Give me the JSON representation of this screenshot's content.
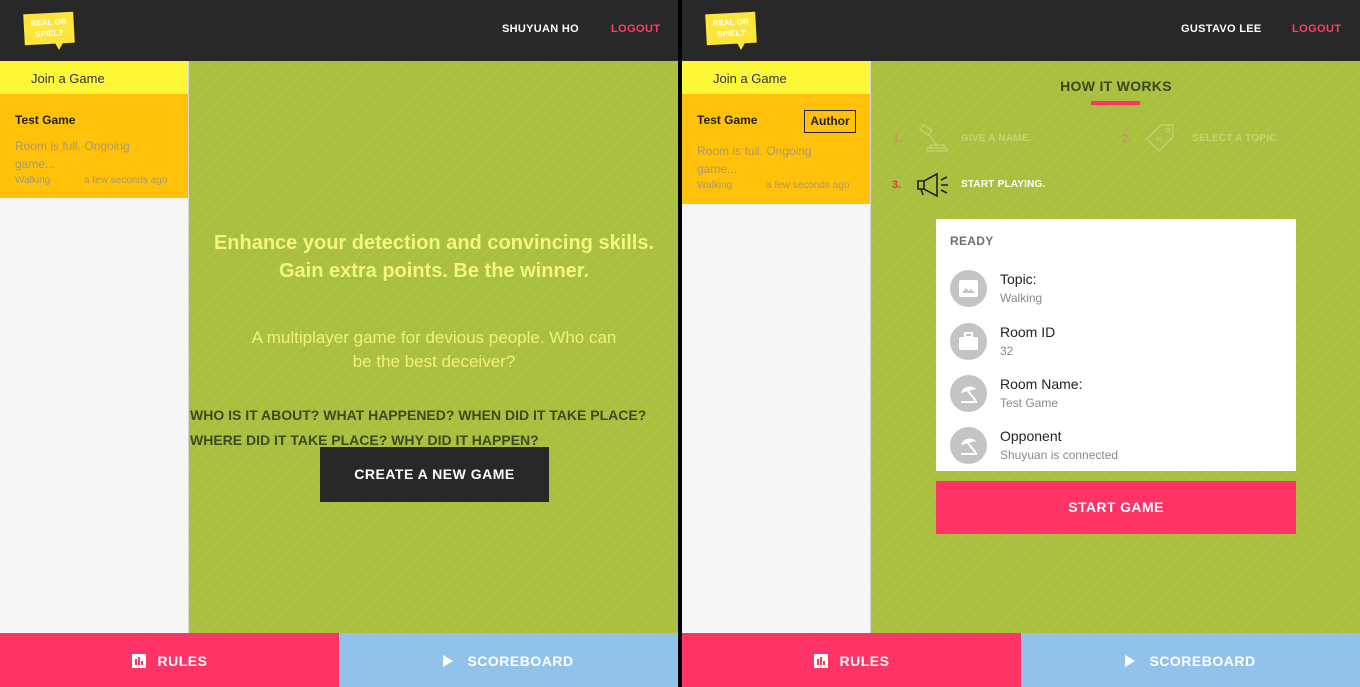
{
  "logo": {
    "line1": "REAL OR",
    "line2": "SPIEL?"
  },
  "left_screen": {
    "user_name": "SHUYUAN HO",
    "logout": "LOGOUT",
    "join_tab": "Join a Game",
    "game": {
      "title": "Test Game",
      "status": "Room is full. Ongoing game...",
      "topic": "Walking",
      "time": "a few seconds ago"
    },
    "hero_title": "Enhance your detection and convincing skills. Gain extra points. Be the winner.",
    "hero_subtitle": "A multiplayer game for devious people. Who can be the best deceiver?",
    "questions_line1": "WHO IS IT ABOUT? WHAT HAPPENED? WHEN DID IT TAKE PLACE?",
    "questions_line2": "WHERE DID IT TAKE PLACE? WHY DID IT HAPPEN?",
    "create_button": "CREATE A NEW GAME",
    "rules": "RULES",
    "scoreboard": "SCOREBOARD"
  },
  "right_screen": {
    "user_name": "GUSTAVO LEE",
    "logout": "LOGOUT",
    "join_tab": "Join a Game",
    "game": {
      "title": "Test Game",
      "author_badge": "Author",
      "status": "Room is full. Ongoing game...",
      "topic": "Walking",
      "time": "a few seconds ago"
    },
    "how_it_works": "HOW IT WORKS",
    "steps": [
      {
        "num": "1.",
        "label": "GIVE A NAME.",
        "icon": "gavel-icon"
      },
      {
        "num": "2.",
        "label": "SELECT A TOPIC.",
        "icon": "tag-icon"
      },
      {
        "num": "3.",
        "label": "START PLAYING.",
        "icon": "megaphone-icon"
      }
    ],
    "ready_label": "READY",
    "info": [
      {
        "label": "Topic:",
        "value": "Walking",
        "icon": "image-icon"
      },
      {
        "label": "Room ID",
        "value": "32",
        "icon": "briefcase-icon"
      },
      {
        "label": "Room Name:",
        "value": "Test Game",
        "icon": "beach-umbrella-icon"
      },
      {
        "label": "Opponent",
        "value": "Shuyuan is connected",
        "icon": "beach-umbrella-icon"
      }
    ],
    "start_button": "START GAME",
    "rules": "RULES",
    "scoreboard": "SCOREBOARD"
  },
  "colors": {
    "topbar": "#282828",
    "accent_pink": "#ff3366",
    "grass_green": "#a9bf3d",
    "yellow_tab": "#fdf738",
    "card_orange": "#ffc10a",
    "scoreboard_blue": "#92c1ea"
  }
}
